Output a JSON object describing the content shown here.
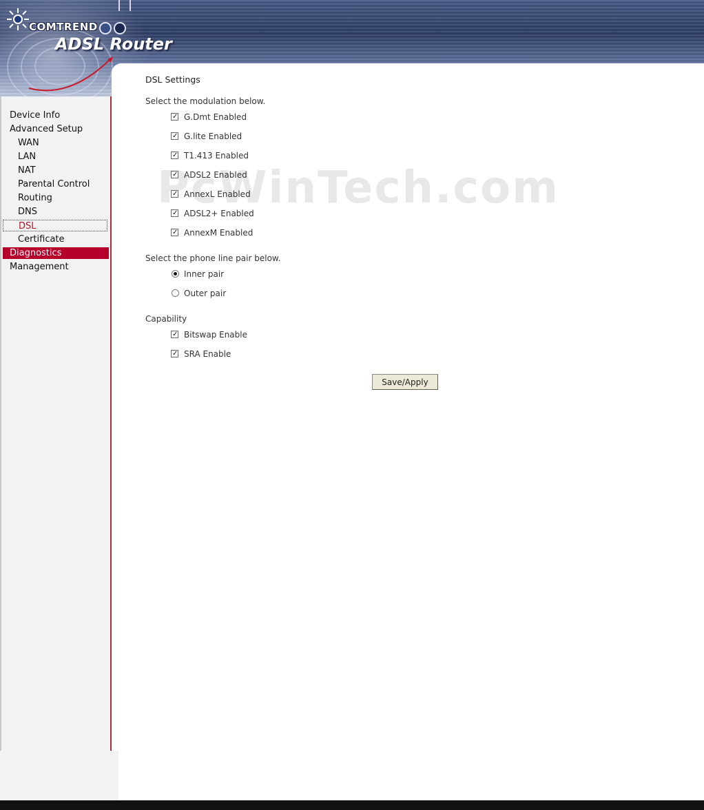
{
  "brand": {
    "logo_text": "COMTREND",
    "product_title": "ADSL Router"
  },
  "sidebar": {
    "items": [
      {
        "label": "Device Info",
        "level": "top",
        "state": "normal"
      },
      {
        "label": "Advanced Setup",
        "level": "top",
        "state": "normal"
      },
      {
        "label": "WAN",
        "level": "sub",
        "state": "normal"
      },
      {
        "label": "LAN",
        "level": "sub",
        "state": "normal"
      },
      {
        "label": "NAT",
        "level": "sub",
        "state": "normal"
      },
      {
        "label": "Parental Control",
        "level": "sub",
        "state": "normal"
      },
      {
        "label": "Routing",
        "level": "sub",
        "state": "normal"
      },
      {
        "label": "DNS",
        "level": "sub",
        "state": "normal"
      },
      {
        "label": "DSL",
        "level": "sub",
        "state": "selected"
      },
      {
        "label": "Certificate",
        "level": "sub",
        "state": "normal"
      },
      {
        "label": "Diagnostics",
        "level": "top",
        "state": "hover"
      },
      {
        "label": "Management",
        "level": "top",
        "state": "normal"
      }
    ]
  },
  "main": {
    "title": "DSL Settings",
    "modulation_label": "Select the modulation below.",
    "modulation_options": [
      {
        "label": "G.Dmt Enabled",
        "checked": true
      },
      {
        "label": "G.lite Enabled",
        "checked": true
      },
      {
        "label": "T1.413 Enabled",
        "checked": true
      },
      {
        "label": "ADSL2 Enabled",
        "checked": true
      },
      {
        "label": "AnnexL Enabled",
        "checked": true
      },
      {
        "label": "ADSL2+ Enabled",
        "checked": true
      },
      {
        "label": "AnnexM Enabled",
        "checked": true
      }
    ],
    "phone_pair_label": "Select the phone line pair below.",
    "phone_pair_options": [
      {
        "label": "Inner pair",
        "selected": true
      },
      {
        "label": "Outer pair",
        "selected": false
      }
    ],
    "capability_label": "Capability",
    "capability_options": [
      {
        "label": "Bitswap Enable",
        "checked": true
      },
      {
        "label": "SRA Enable",
        "checked": true
      }
    ],
    "save_label": "Save/Apply"
  },
  "watermark": "PcWinTech.com",
  "colors": {
    "accent_red": "#b5002b",
    "selected_text": "#b0122a",
    "banner_dark": "#2e3e66"
  }
}
